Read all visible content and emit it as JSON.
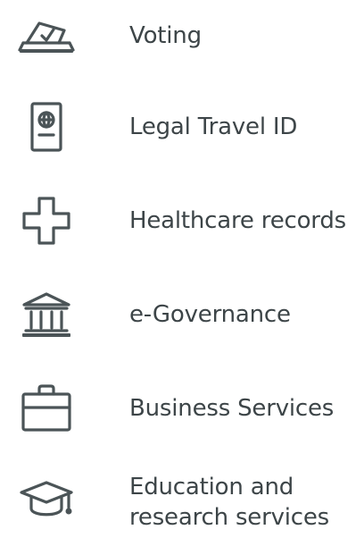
{
  "services": [
    {
      "label": "Voting",
      "icon": "ballot-box-icon"
    },
    {
      "label": "Legal Travel ID",
      "icon": "passport-icon"
    },
    {
      "label": "Healthcare records",
      "icon": "medical-cross-icon"
    },
    {
      "label": "e-Governance",
      "icon": "government-building-icon"
    },
    {
      "label": "Business Services",
      "icon": "briefcase-icon"
    },
    {
      "label": "Education and research services",
      "icon": "graduation-cap-icon"
    }
  ],
  "colors": {
    "text": "#3d4548",
    "icon": "#4b5457",
    "background": "#ffffff"
  }
}
